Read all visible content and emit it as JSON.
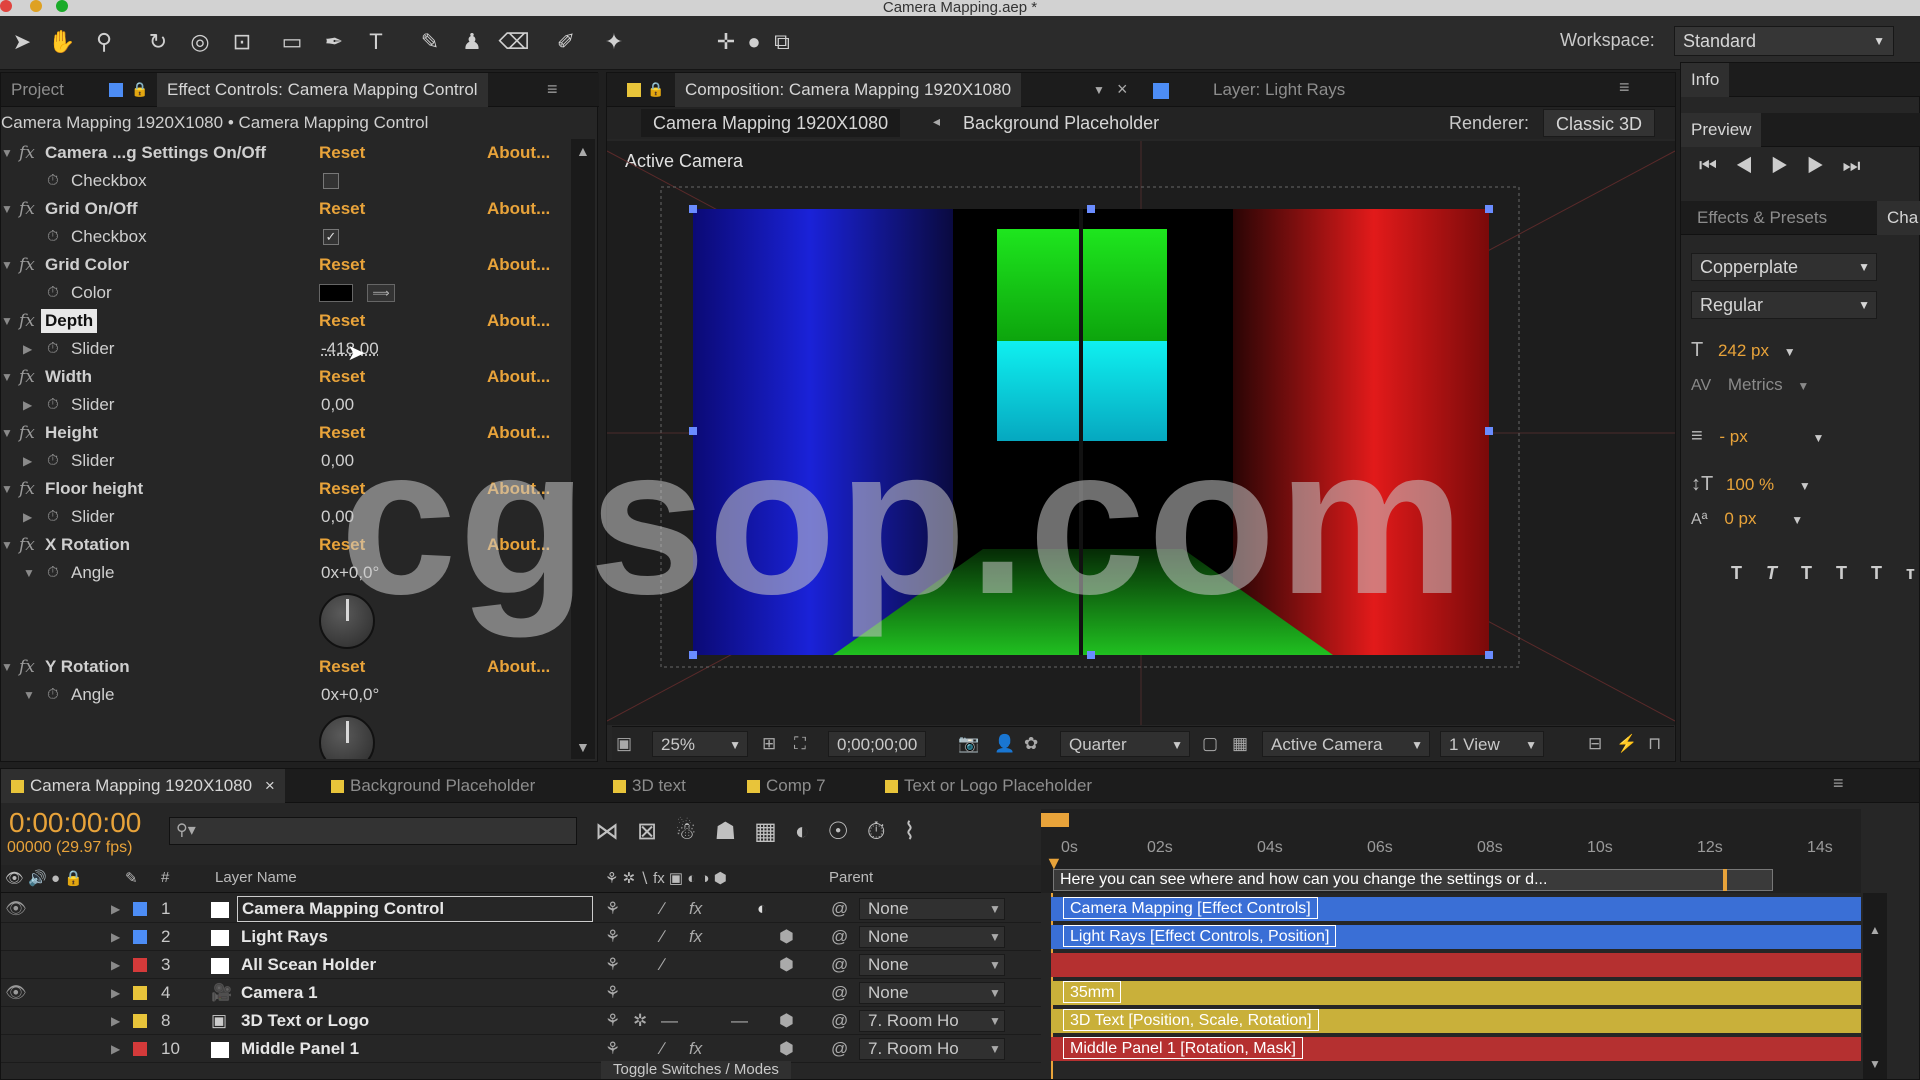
{
  "app": {
    "title": "Camera Mapping.aep *"
  },
  "workspace": {
    "label": "Workspace:",
    "value": "Standard"
  },
  "left_panel": {
    "tabs": [
      "Project",
      "Effect Controls: Camera Mapping Control"
    ],
    "breadcrumb": "Camera Mapping 1920X1080 • Camera Mapping Control",
    "reset_label": "Reset",
    "about_label": "About...",
    "effects": [
      {
        "name": "Camera ...g Settings On/Off",
        "sub": "Checkbox"
      },
      {
        "name": "Grid On/Off",
        "sub": "Checkbox"
      },
      {
        "name": "Grid Color",
        "sub": "Color"
      },
      {
        "name": "Depth",
        "sub": "Slider",
        "value": "-418,00"
      },
      {
        "name": "Width",
        "sub": "Slider",
        "value": "0,00"
      },
      {
        "name": "Height",
        "sub": "Slider",
        "value": "0,00"
      },
      {
        "name": "Floor height",
        "sub": "Slider",
        "value": "0,00"
      },
      {
        "name": "X Rotation",
        "sub": "Angle",
        "value": "0x+0,0°"
      },
      {
        "name": "Y Rotation",
        "sub": "Angle",
        "value": "0x+0,0°"
      }
    ]
  },
  "composition": {
    "tab": "Composition: Camera Mapping 1920X1080",
    "layer_tab": "Layer: Light Rays",
    "breadcrumb_current": "Camera Mapping 1920X1080",
    "breadcrumb_next": "Background Placeholder",
    "renderer_label": "Renderer:",
    "renderer_value": "Classic 3D",
    "view_label": "Active Camera",
    "zoom": "25%",
    "timecode": "0;00;00;00",
    "resolution": "Quarter",
    "camera_view": "Active Camera",
    "views": "1 View"
  },
  "right_panel": {
    "info_tab": "Info",
    "preview_tab": "Preview",
    "effects_tab": "Effects & Presets",
    "char_tab": "Cha",
    "font": "Copperplate",
    "style": "Regular",
    "font_size": "242 px",
    "kerning": "Metrics",
    "leading": "- px",
    "vscale": "100 %",
    "baseline": "0 px",
    "text_style_buttons": [
      "T",
      "T",
      "TT",
      "Tт"
    ]
  },
  "timeline": {
    "tabs": [
      "Camera Mapping 1920X1080",
      "Background Placeholder",
      "3D text",
      "Comp 7",
      "Text or Logo Placeholder"
    ],
    "timecode": "0:00:00:00",
    "frames": "00000 (29.97 fps)",
    "columns": {
      "num": "#",
      "layer_name": "Layer Name",
      "parent": "Parent"
    },
    "ruler": [
      "0s",
      "02s",
      "04s",
      "06s",
      "08s",
      "10s",
      "12s",
      "14s"
    ],
    "comment": "Here you can see where and how can you change the settings or d...",
    "layers": [
      {
        "num": "1",
        "name": "Camera Mapping Control",
        "parent": "None",
        "color": "#4d8df5",
        "bar_label": "Camera Mapping [Effect Controls]",
        "bar_color": "#3a6fd6"
      },
      {
        "num": "2",
        "name": "Light Rays",
        "parent": "None",
        "color": "#4d8df5",
        "bar_label": "Light Rays [Effect Controls, Position]",
        "bar_color": "#3a6fd6"
      },
      {
        "num": "3",
        "name": "All Scean Holder",
        "parent": "None",
        "color": "#d43a3a",
        "bar_label": "",
        "bar_color": "#b53030"
      },
      {
        "num": "4",
        "name": "Camera 1",
        "parent": "None",
        "color": "#e8c43a",
        "bar_label": "35mm",
        "bar_color": "#c9b03a"
      },
      {
        "num": "8",
        "name": "3D Text or Logo",
        "parent": "7. Room Ho",
        "color": "#e8c43a",
        "bar_label": "3D Text [Position, Scale, Rotation]",
        "bar_color": "#c9b03a"
      },
      {
        "num": "10",
        "name": "Middle Panel 1",
        "parent": "7. Room Ho",
        "color": "#d43a3a",
        "bar_label": "Middle Panel 1 [Rotation, Mask]",
        "bar_color": "#b53030"
      }
    ],
    "toggle_label": "Toggle Switches / Modes"
  },
  "watermark": "cgsop.com"
}
